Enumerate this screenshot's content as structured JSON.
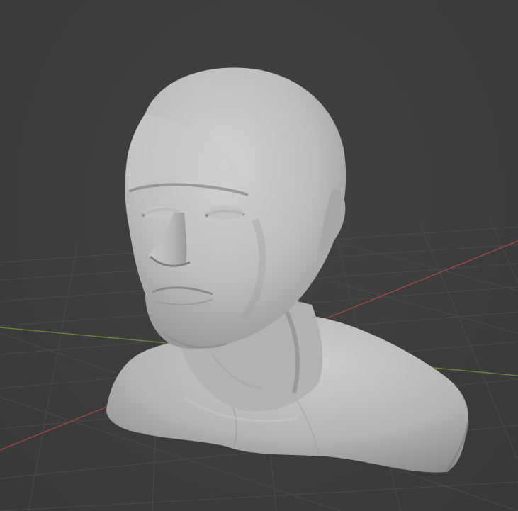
{
  "viewport": {
    "background_color": "#3d3d3d",
    "grid_color": "#4a4a4a",
    "x_axis_color": "#9c4a4f",
    "y_axis_color": "#6c8a3a",
    "object": "head-bust-sculpt-mesh",
    "mesh_color": "#b9b9b9"
  }
}
